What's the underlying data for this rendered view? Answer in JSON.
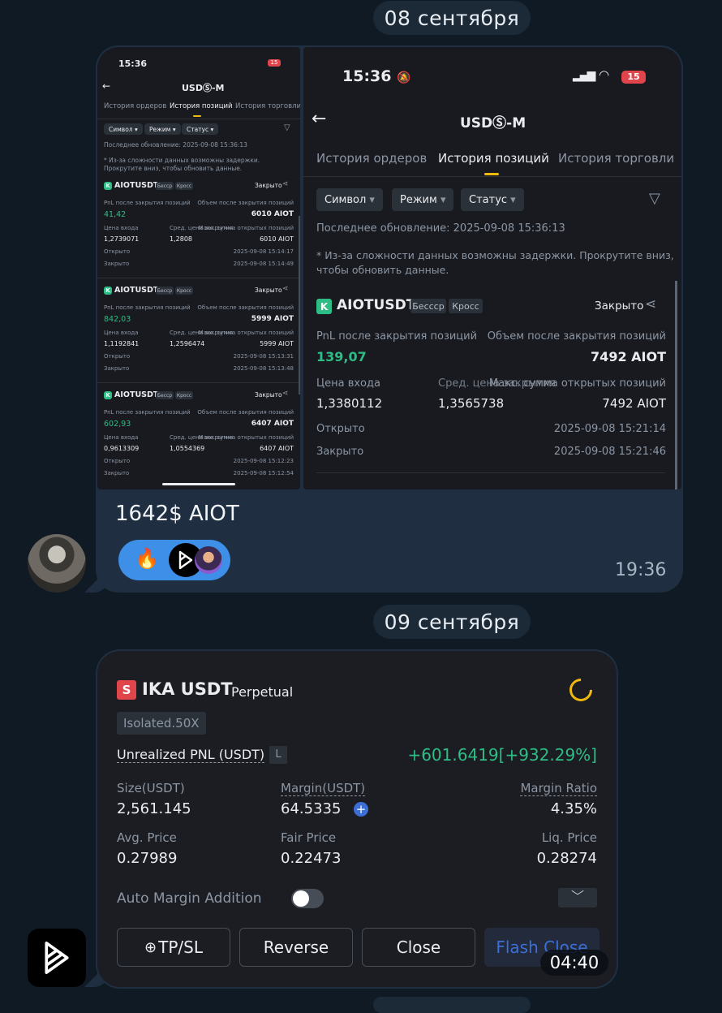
{
  "dates": {
    "first": "08 сентября",
    "second": "09 сентября"
  },
  "message1": {
    "caption": "1642$ AIOT",
    "time": "19:36",
    "reactions": [
      "🔥"
    ]
  },
  "screenshot_small": {
    "status_time": "15:36",
    "battery": "15",
    "title": "USDⓈ-M",
    "tabs": [
      "История ордеров",
      "История позиций",
      "История торговли"
    ],
    "filters": [
      "Символ",
      "Режим",
      "Статус"
    ],
    "last_update": "Последнее обновление: 2025-09-08 15:36:13",
    "notice": "* Из-за сложности данных возможны задержки. Прокрутите вниз, чтобы обновить данные.",
    "labels": {
      "closed": "Закрыто",
      "pnl": "PnL после закрытия позиций",
      "volume": "Объем после закрытия позиций",
      "entry": "Цена входа",
      "avg": "Сред. цена закрытия",
      "max": "Макс. сумма открытых позиций",
      "opened": "Открыто",
      "closed_at": "Закрыто"
    },
    "positions": [
      {
        "symbol": "AIOTUSDT",
        "tag1": "Бесср",
        "tag2": "Кросс",
        "pnl": "41,42",
        "volume": "6010 AIOT",
        "entry": "1,2739071",
        "avg": "1,2808",
        "max": "6010 AIOT",
        "opened": "2025-09-08 15:14:17",
        "closed": "2025-09-08 15:14:49"
      },
      {
        "symbol": "AIOTUSDT",
        "tag1": "Бесср",
        "tag2": "Кросс",
        "pnl": "842,03",
        "volume": "5999 AIOT",
        "entry": "1,1192841",
        "avg": "1,2596474",
        "max": "5999 AIOT",
        "opened": "2025-09-08 15:13:31",
        "closed": "2025-09-08 15:13:48"
      },
      {
        "symbol": "AIOTUSDT",
        "tag1": "Бесср",
        "tag2": "Кросс",
        "pnl": "602,93",
        "volume": "6407 AIOT",
        "entry": "0,9613309",
        "avg": "1,0554369",
        "max": "6407 AIOT",
        "opened": "2025-09-08 15:12:23",
        "closed": "2025-09-08 15:12:54"
      }
    ]
  },
  "screenshot_large": {
    "status_time": "15:36",
    "battery": "15",
    "title": "USDⓈ-M",
    "tabs": [
      "История ордеров",
      "История позиций",
      "История торговли"
    ],
    "filters": [
      "Символ",
      "Режим",
      "Статус"
    ],
    "last_update": "Последнее обновление: 2025-09-08 15:36:13",
    "notice_line1": "* Из-за сложности данных возможны задержки. Прокрутите вниз,",
    "notice_line2": "чтобы обновить данные.",
    "position": {
      "symbol": "AIOTUSDT",
      "tag1": "Бессср",
      "tag2": "Кросс",
      "status": "Закрыто",
      "pnl_label": "PnL после закрытия позиций",
      "pnl": "139,07",
      "volume_label": "Объем после закрытия позиций",
      "volume": "7492 AIOT",
      "entry_label": "Цена входа",
      "entry": "1,3380112",
      "avg_label": "Сред. цена закрытия",
      "avg": "1,3565738",
      "max_label": "Макс. сумма открытых позиций",
      "max": "7492 AIOT",
      "opened_label": "Открыто",
      "opened": "2025-09-08 15:21:14",
      "closed_label": "Закрыто",
      "closed": "2025-09-08 15:21:46"
    }
  },
  "message2": {
    "time": "04:40",
    "badge": "S",
    "pair": "IKA USDT",
    "pair_type": "Perpetual",
    "mode": "Isolated.50X",
    "unrealized_label": "Unrealized PNL (USDT)",
    "unrealized_tag": "L",
    "unrealized_value": "+601.6419[+932.29%]",
    "size_label": "Size(USDT)",
    "size": "2,561.145",
    "margin_label": "Margin(USDT)",
    "margin": "64.5335",
    "ratio_label": "Margin Ratio",
    "ratio": "4.35%",
    "avg_label": "Avg. Price",
    "avg": "0.27989",
    "fair_label": "Fair Price",
    "fair": "0.22473",
    "liq_label": "Liq. Price",
    "liq": "0.28274",
    "auto_margin_label": "Auto Margin Addition",
    "buttons": {
      "tpsl": "TP/SL",
      "reverse": "Reverse",
      "close": "Close",
      "flash": "Flash Close"
    }
  },
  "colors": {
    "green": "#2ebd85",
    "accent": "#f0b90b",
    "reaction_bg": "#3d8fe8",
    "chat_bg": "#0f1a24",
    "bubble": "#1f2f41"
  }
}
